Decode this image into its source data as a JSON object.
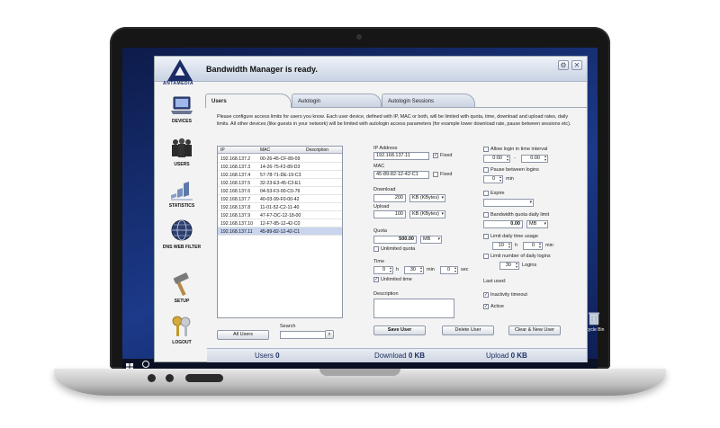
{
  "app": {
    "title": "Bandwidth Manager is ready.",
    "logo_text": "ANTAMEDIA"
  },
  "colors": {
    "accent": "#1c2f66",
    "selection": "#c9d5ee",
    "desktop": "#1c3a8a"
  },
  "sidebar": {
    "items": [
      {
        "label": "DEVICES",
        "icon": "laptop-icon"
      },
      {
        "label": "USERS",
        "icon": "users-icon"
      },
      {
        "label": "STATISTICS",
        "icon": "statistics-icon"
      },
      {
        "label": "DNS WEB FILTER",
        "icon": "globe-icon"
      },
      {
        "label": "SETUP",
        "icon": "hammer-icon"
      },
      {
        "label": "LOGOUT",
        "icon": "keys-icon"
      }
    ]
  },
  "tabs": [
    "Users",
    "Autologin",
    "Autologin Sessions"
  ],
  "instructions": "Please configure access limits for users you know. Each user device, defined with IP, MAC or both, will be limited with quota, time, download and upload rates, daily limits. All other devices (like guests in your network) will be limited with autologin access parameters (for example lower download rate, pause between sessions etc).",
  "table": {
    "columns": [
      "IP",
      "MAC",
      "Description"
    ],
    "rows": [
      {
        "ip": "192.168.137.2",
        "mac": "00-26-45-CF-89-09",
        "desc": ""
      },
      {
        "ip": "192.168.137.3",
        "mac": "14-26-75-F2-89-D3",
        "desc": ""
      },
      {
        "ip": "192.168.137.4",
        "mac": "57-78-71-DE-19-C3",
        "desc": ""
      },
      {
        "ip": "192.168.137.5",
        "mac": "32-23-E3-45-C3-E1",
        "desc": ""
      },
      {
        "ip": "192.168.137.6",
        "mac": "04-53-F3-00-C0-76",
        "desc": ""
      },
      {
        "ip": "192.168.137.7",
        "mac": "40-03-99-F0-00-42",
        "desc": ""
      },
      {
        "ip": "192.168.137.8",
        "mac": "11-01-52-C2-11-40",
        "desc": ""
      },
      {
        "ip": "192.168.137.9",
        "mac": "47-F7-DC-12-18-00",
        "desc": ""
      },
      {
        "ip": "192.168.137.10",
        "mac": "12-F7-85-12-42-C0",
        "desc": ""
      },
      {
        "ip": "192.168.137.11",
        "mac": "45-89-82-12-42-C1",
        "desc": ""
      }
    ],
    "selected_index": 9
  },
  "buttons": {
    "all_users": "All Users",
    "save_user": "Save User",
    "delete_user": "Delete User",
    "clear_new_user": "Clear & New User"
  },
  "search": {
    "label": "Search",
    "value": ""
  },
  "form": {
    "ip_label": "IP Address",
    "ip_value": "192.168.137.11",
    "ip_fixed_label": "Fixed",
    "ip_fixed_checked": true,
    "mac_label": "MAC",
    "mac_value": "45-89-82-12-42-C1",
    "mac_fixed_label": "Fixed",
    "mac_fixed_checked": false,
    "download_label": "Download",
    "download_value": "200",
    "download_unit": "KB (KBytes)",
    "upload_label": "Upload",
    "upload_value": "100",
    "upload_unit": "KB (KBytes)",
    "quota_label": "Quota",
    "quota_value": "500.00",
    "quota_unit": "MB",
    "unlimited_quota_label": "Unlimited quota",
    "unlimited_quota_checked": false,
    "time_label": "Time",
    "time_h_value": "0",
    "time_h_unit": "h",
    "time_min_value": "30",
    "time_min_unit": "min",
    "time_sec_value": "0",
    "time_sec_unit": "sec",
    "unlimited_time_label": "Unlimited time",
    "unlimited_time_checked": true,
    "description_label": "Description",
    "description_value": ""
  },
  "right": {
    "allow_login_label": "Allow login in time interval",
    "allow_login_checked": false,
    "interval_from": "0:00",
    "interval_sep": "-",
    "interval_to": "0:00",
    "pause_label": "Pause between logins",
    "pause_checked": false,
    "pause_value": "0",
    "pause_unit": "min",
    "expire_label": "Expire",
    "expire_checked": false,
    "expire_value": "",
    "daily_quota_label": "Bandwidth quota daily limit",
    "daily_quota_checked": false,
    "daily_quota_value": "0.00",
    "daily_quota_unit": "MB",
    "daily_time_label": "Limit daily time usage",
    "daily_time_checked": false,
    "daily_time_h_value": "10",
    "daily_time_h_unit": "h",
    "daily_time_min_value": "0",
    "daily_time_min_unit": "min",
    "daily_logins_label": "Limit number of daily logins",
    "daily_logins_checked": false,
    "daily_logins_value": "30",
    "daily_logins_unit": "Logins",
    "last_used_label": "Last used:",
    "inactivity_label": "Inactivity timeout",
    "inactivity_checked": true,
    "active_label": "Active",
    "active_checked": true
  },
  "status": {
    "users_label": "Users",
    "users_value": "0",
    "download_label": "Download",
    "download_value": "0 KB",
    "upload_label": "Upload",
    "upload_value": "0 KB"
  },
  "desktop": {
    "recycle_label": "Recycle Bin"
  }
}
